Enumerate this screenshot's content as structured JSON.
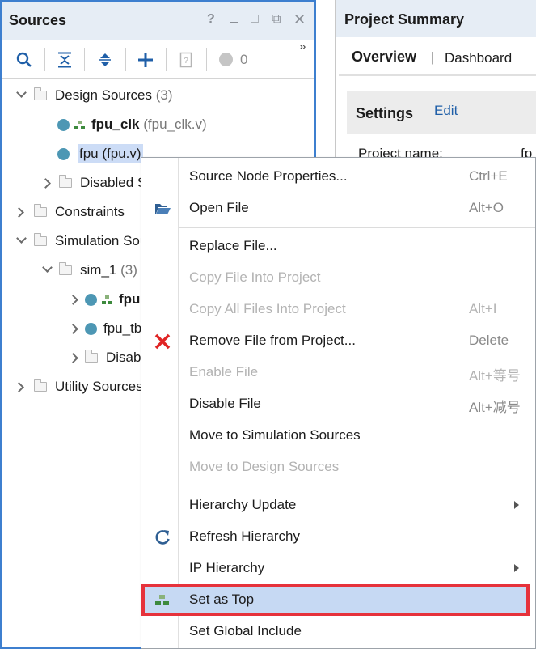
{
  "sources_panel": {
    "title": "Sources",
    "header_buttons": [
      "?",
      "_",
      "□",
      "⧉",
      "✕"
    ],
    "toolbar": {
      "counter": "0",
      "overflow": "»"
    },
    "tree": {
      "design_sources": {
        "label": "Design Sources",
        "count": "(3)"
      },
      "fpu_clk": {
        "name": "fpu_clk",
        "file": "(fpu_clk.v)"
      },
      "fpu": {
        "label": "fpu (fpu.v)"
      },
      "disabled_1": {
        "label": "Disabled S"
      },
      "constraints": {
        "label": "Constraints"
      },
      "simulation_sources": {
        "label": "Simulation Sou"
      },
      "sim_1": {
        "label": "sim_1",
        "count": "(3)"
      },
      "sim_fpu": {
        "label": "fpu"
      },
      "fpu_tb": {
        "label": "fpu_tb"
      },
      "disabled_2": {
        "label": "Disab"
      },
      "utility_sources": {
        "label": "Utility Sources"
      }
    }
  },
  "summary_panel": {
    "title": "Project Summary",
    "tabs": {
      "overview": "Overview",
      "separator": "|",
      "dashboard": "Dashboard"
    },
    "settings": {
      "heading": "Settings",
      "edit": "Edit"
    },
    "project_name_label": "Project name:",
    "project_name_value": "fp"
  },
  "context_menu": {
    "items": [
      {
        "label": "Source Node Properties...",
        "shortcut": "Ctrl+E",
        "enabled": true
      },
      {
        "label": "Open File",
        "shortcut": "Alt+O",
        "enabled": true,
        "icon": "folder-open-icon"
      },
      {
        "label": "Replace File...",
        "shortcut": "",
        "enabled": true
      },
      {
        "label": "Copy File Into Project",
        "shortcut": "",
        "enabled": false
      },
      {
        "label": "Copy All Files Into Project",
        "shortcut": "Alt+I",
        "enabled": false
      },
      {
        "label": "Remove File from Project...",
        "shortcut": "Delete",
        "enabled": true,
        "icon": "remove-x-icon"
      },
      {
        "label": "Enable File",
        "shortcut": "Alt+等号",
        "enabled": false
      },
      {
        "label": "Disable File",
        "shortcut": "Alt+减号",
        "enabled": true
      },
      {
        "label": "Move to Simulation Sources",
        "shortcut": "",
        "enabled": true
      },
      {
        "label": "Move to Design Sources",
        "shortcut": "",
        "enabled": false
      },
      {
        "label": "Hierarchy Update",
        "shortcut": "",
        "enabled": true,
        "submenu": true
      },
      {
        "label": "Refresh Hierarchy",
        "shortcut": "",
        "enabled": true,
        "icon": "refresh-icon"
      },
      {
        "label": "IP Hierarchy",
        "shortcut": "",
        "enabled": true,
        "submenu": true
      },
      {
        "label": "Set as Top",
        "shortcut": "",
        "enabled": true,
        "icon": "hierarchy-icon",
        "highlighted": true
      },
      {
        "label": "Set Global Include",
        "shortcut": "",
        "enabled": true
      }
    ]
  },
  "colors": {
    "panel_border": "#3d7fcf",
    "selection": "#ccdcf6",
    "highlight_outline": "#e6323b",
    "hdl_dot": "#4d97b4",
    "remove_icon": "#e02424"
  }
}
